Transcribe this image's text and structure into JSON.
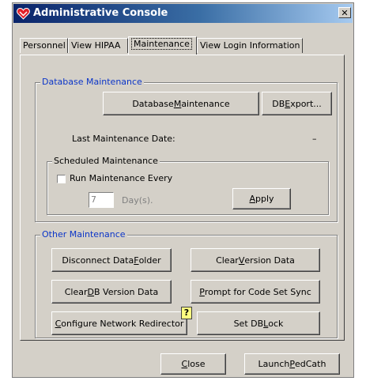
{
  "window": {
    "title": "Administrative Console",
    "close_glyph": "✕",
    "icon": "heart-icon",
    "colors": {
      "title_start": "#0a246a",
      "title_end": "#a6caf0",
      "face": "#d4d0c8",
      "accent": "#0b35c8"
    }
  },
  "tabs": [
    {
      "label": "Personnel"
    },
    {
      "label": "View HIPAA"
    },
    {
      "label": "Maintenance",
      "active": true
    },
    {
      "label": "View Login Information"
    }
  ],
  "database_maintenance": {
    "legend": "Database Maintenance",
    "db_maintenance_button": {
      "before": "Database ",
      "accel": "M",
      "after": "aintenance"
    },
    "db_export_button": {
      "before": "DB ",
      "accel": "E",
      "after": "xport..."
    },
    "last_date_label": "Last Maintenance Date:",
    "last_date_value": "–",
    "scheduled": {
      "legend": "Scheduled Maintenance",
      "run_every_label": "Run Maintenance Every",
      "run_every_checked": false,
      "days_value": "7",
      "days_unit": "Day(s).",
      "apply_button": {
        "before": "",
        "accel": "A",
        "after": "pply"
      }
    }
  },
  "other_maintenance": {
    "legend": "Other Maintenance",
    "disconnect_button": {
      "before": "Disconnect Data ",
      "accel": "F",
      "after": "older"
    },
    "clear_version_button": {
      "before": "Clear ",
      "accel": "V",
      "after": "ersion Data"
    },
    "clear_db_version_button": {
      "before": "Clear ",
      "accel": "D",
      "after": "B Version Data"
    },
    "prompt_code_set_button": {
      "before": "",
      "accel": "P",
      "after": "rompt for Code Set Sync"
    },
    "configure_redirector_button": {
      "before": "",
      "accel": "C",
      "after": "onfigure Network Redirector"
    },
    "help_glyph": "?",
    "set_db_lock_button": {
      "before": "Set DB ",
      "accel": "L",
      "after": "ock"
    }
  },
  "footer": {
    "close_button": {
      "before": "",
      "accel": "C",
      "after": "lose"
    },
    "launch_button": {
      "before": "Launch ",
      "accel": "P",
      "after": "edCath"
    }
  }
}
